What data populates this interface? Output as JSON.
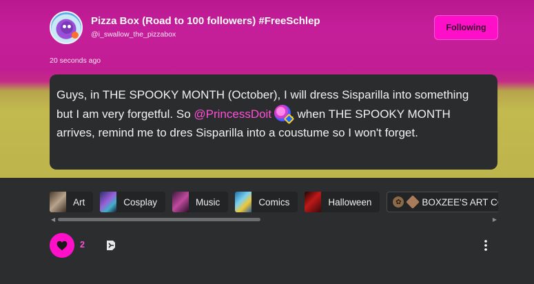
{
  "blog": {
    "title": "Pizza Box (Road to 100 followers) #FreeSchlep",
    "handle": "@i_swallow_the_pizzabox",
    "follow_label": "Following"
  },
  "post": {
    "timestamp": "20 seconds ago",
    "text_before": "Guys, in THE SPOOKY MONTH (October), I will dress Sisparilla into something but I am very forgetful. So ",
    "mention": "@PrincessDoit",
    "text_after": ", when THE SPOOKY MONTH arrives, remind me to dres Sisparilla into a coustume so I won't forget."
  },
  "tags": [
    {
      "label": "Art",
      "color": "#7a6a5a"
    },
    {
      "label": "Cosplay",
      "color": "#5d4b9e"
    },
    {
      "label": "Music",
      "color": "#8a3f8e"
    },
    {
      "label": "Comics",
      "color": "#3b8fc2"
    },
    {
      "label": "Halloween",
      "color": "#9e1f1f"
    }
  ],
  "community_tag": {
    "label": "BOXZEE'S ART COMMUN"
  },
  "actions": {
    "like_count": "2"
  },
  "colors": {
    "accent": "#ff10c8",
    "card": "#2a2c2d",
    "page": "#2b2d2f"
  }
}
